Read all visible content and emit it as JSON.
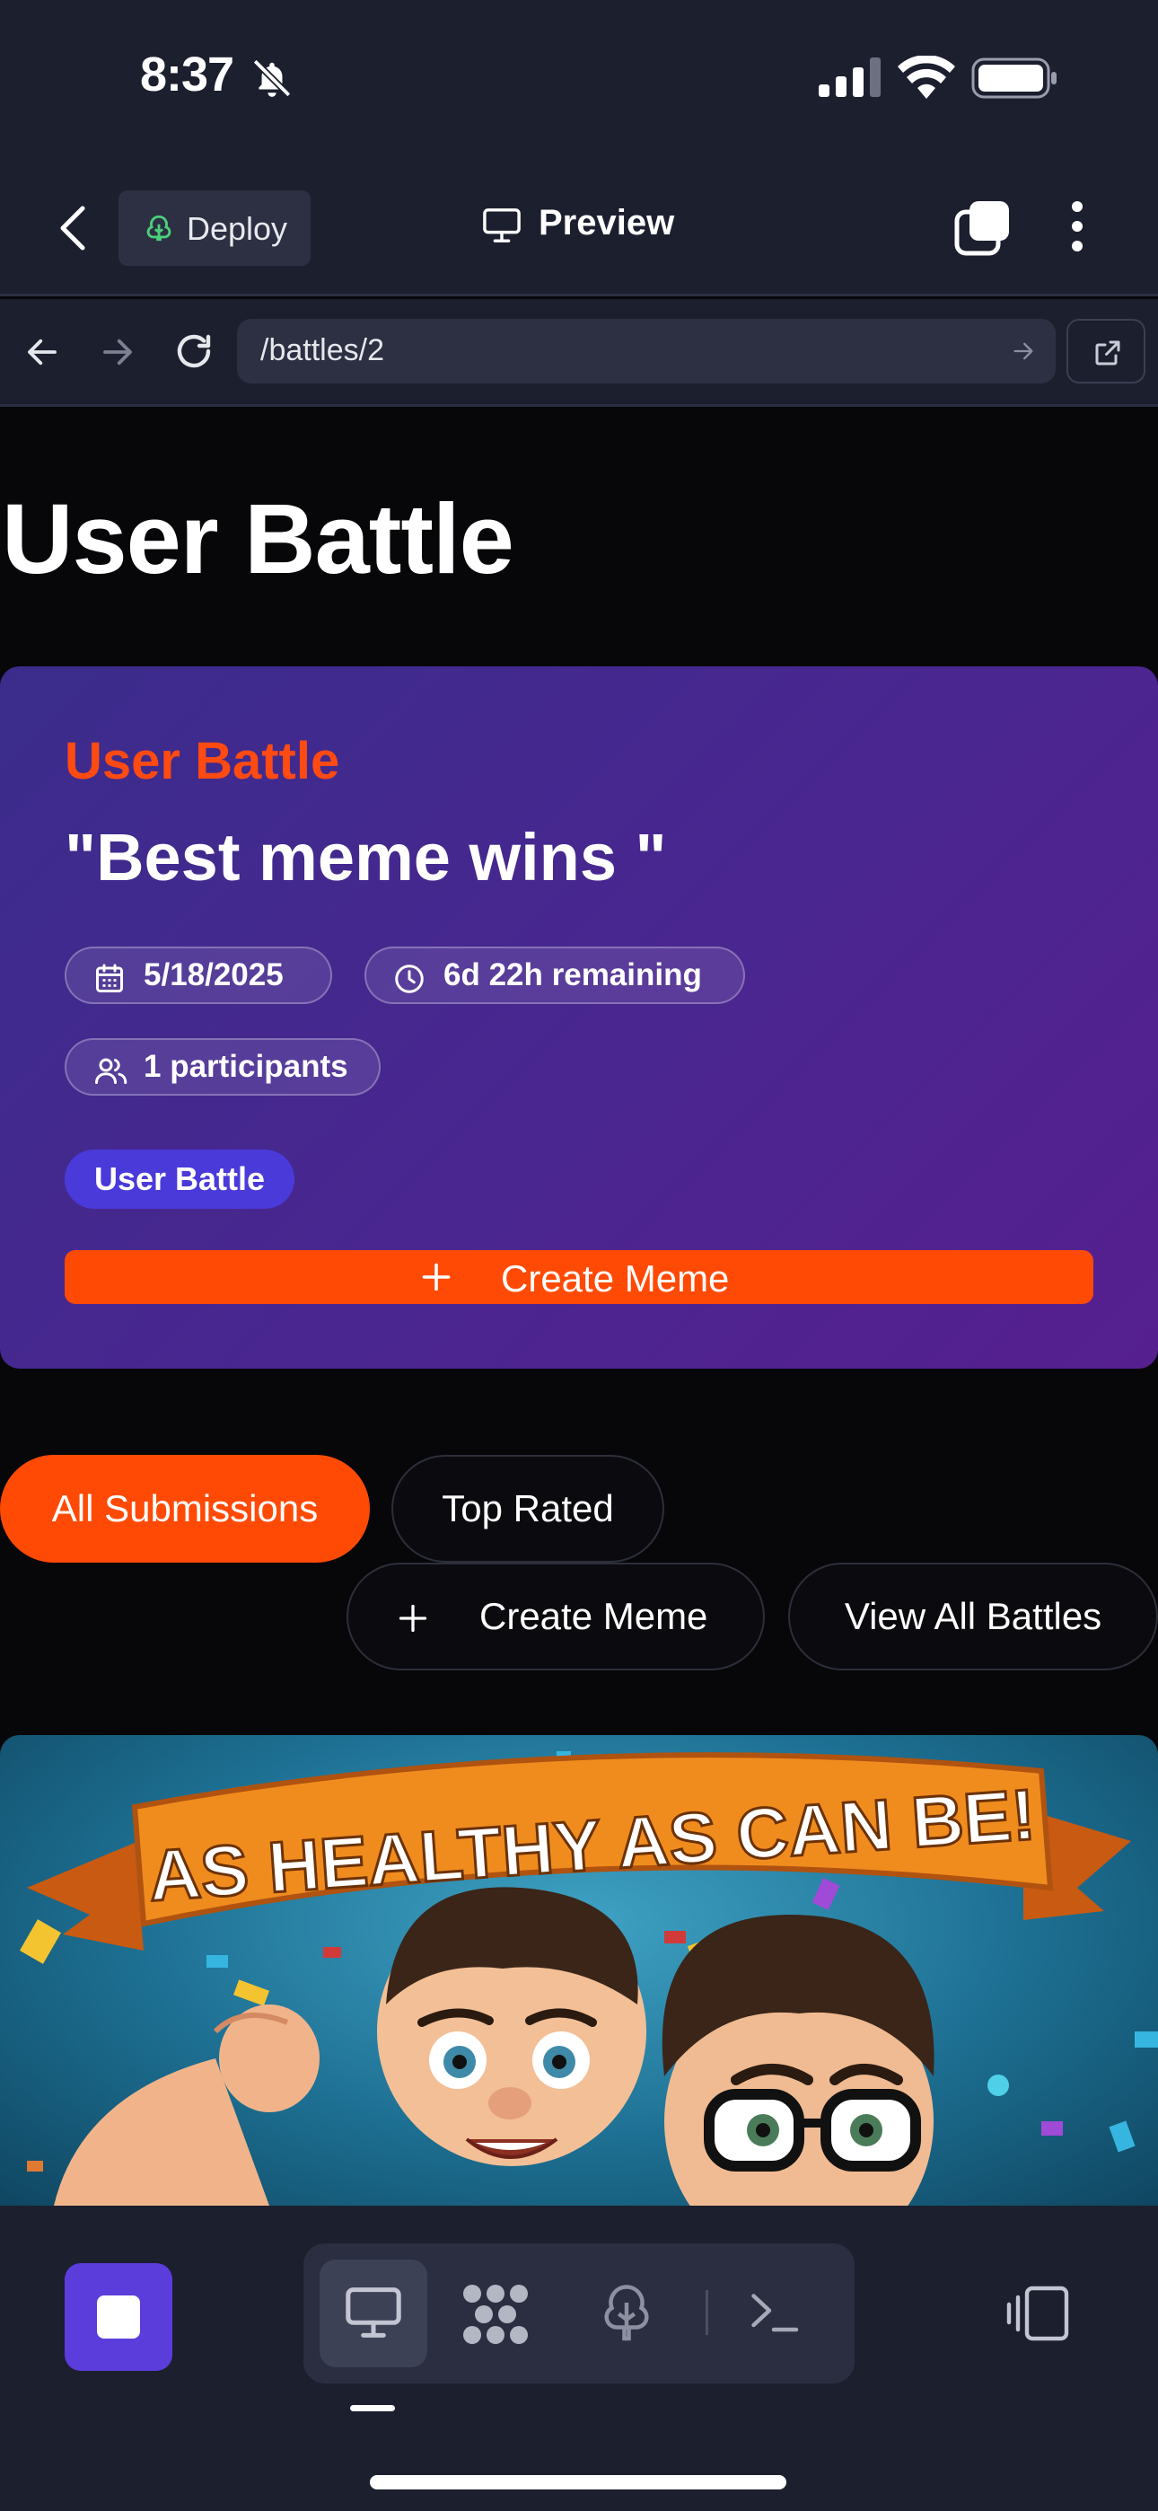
{
  "status_bar": {
    "time": "8:37"
  },
  "app_bar": {
    "deploy_label": "Deploy",
    "preview_label": "Preview"
  },
  "browser": {
    "url": "/battles/2"
  },
  "page": {
    "title": "User Battle"
  },
  "battle": {
    "kicker": "User Battle",
    "title": "\"Best meme wins \"",
    "date": "5/18/2025",
    "remaining": "6d 22h remaining",
    "participants": "1 participants",
    "type_badge": "User Battle",
    "create_label": "Create Meme"
  },
  "filters": {
    "all": "All Submissions",
    "top": "Top Rated",
    "create": "Create Meme",
    "view_all": "View All Battles"
  },
  "meme": {
    "banner_text": "AS HEALTHY AS CAN BE!"
  },
  "colors": {
    "accent": "#ff4a06",
    "card_start": "#3b2c8c",
    "card_end": "#561f90",
    "badge": "#4a3ad9",
    "chrome": "#1c1f2e"
  },
  "icons": [
    "bell-slash-icon",
    "signal-icon",
    "wifi-icon",
    "battery-icon",
    "chevron-left-icon",
    "tree-icon",
    "monitor-icon",
    "tabs-icon",
    "more-vertical-icon",
    "arrow-left-icon",
    "arrow-right-icon",
    "reload-icon",
    "external-link-icon",
    "calendar-icon",
    "clock-icon",
    "users-icon",
    "plus-icon",
    "stop-icon",
    "grid-icon",
    "terminal-icon",
    "device-icon"
  ]
}
